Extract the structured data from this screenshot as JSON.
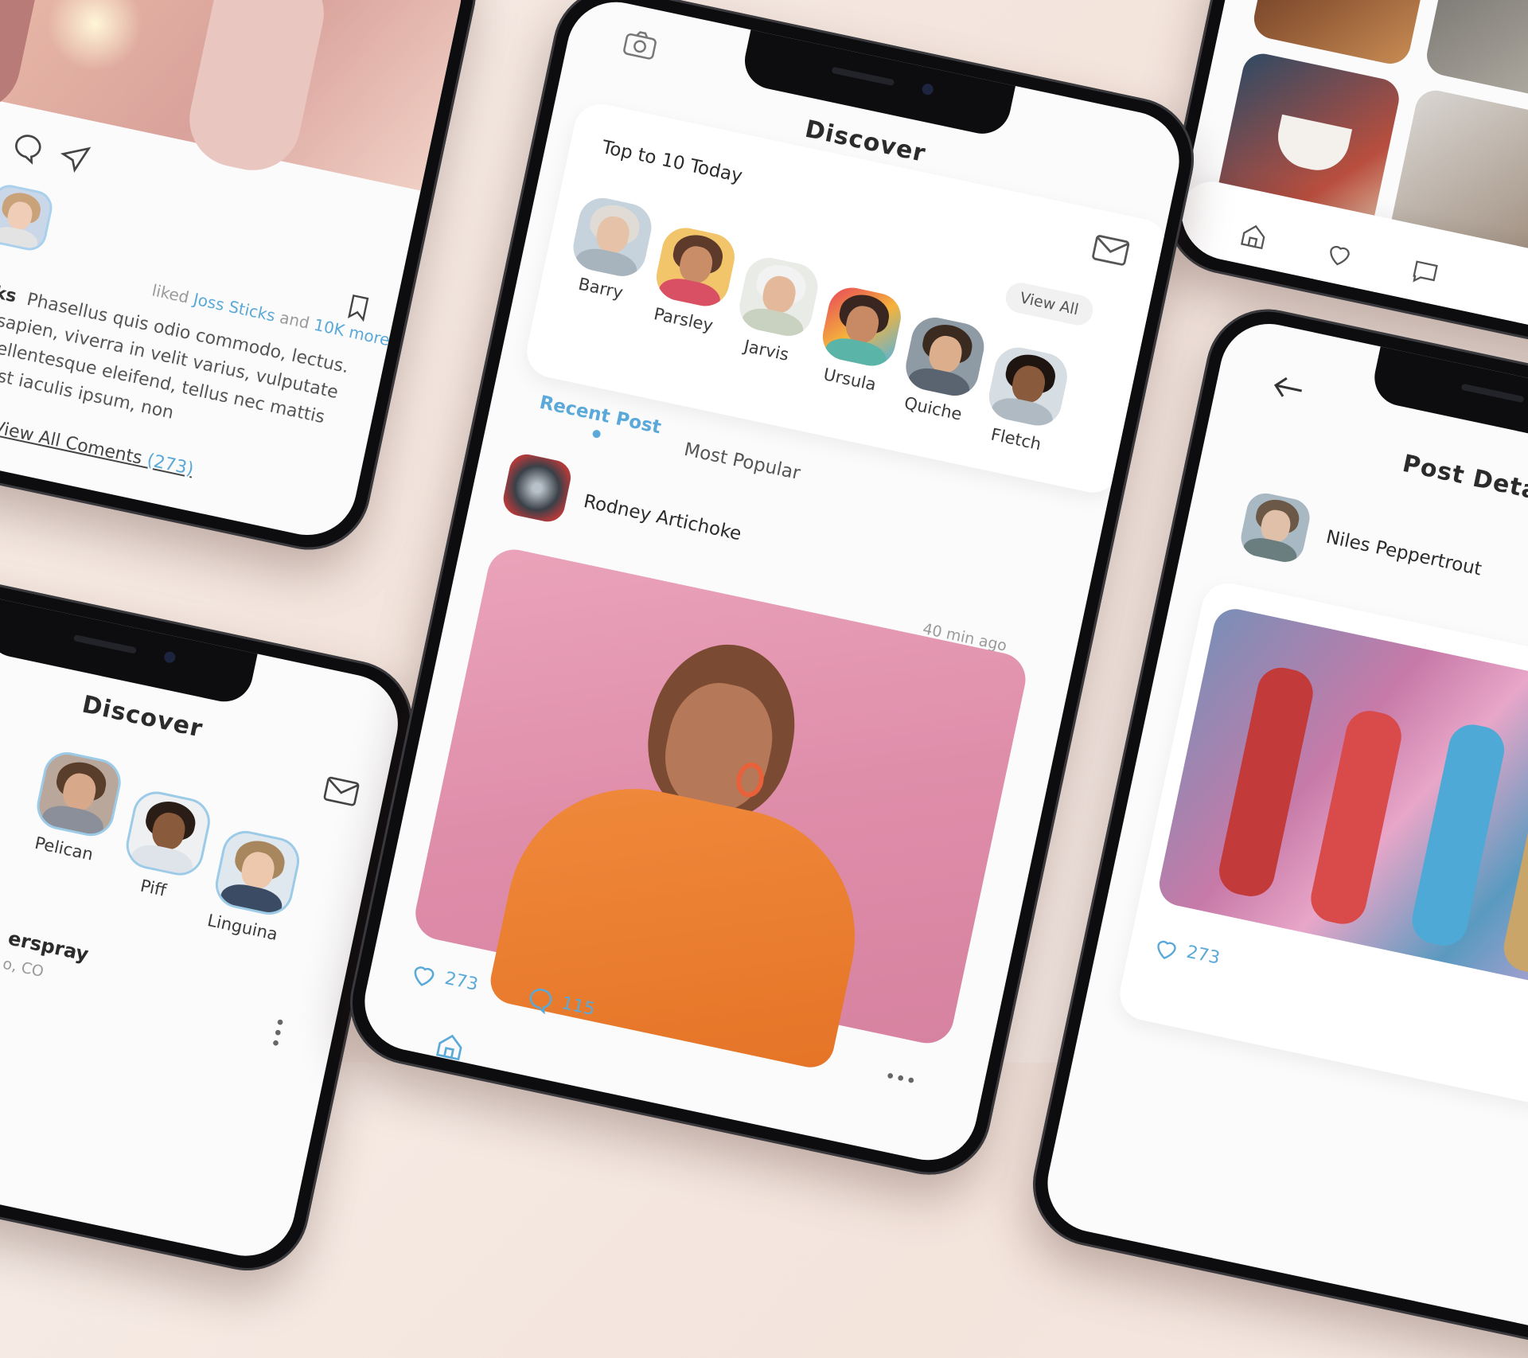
{
  "colors": {
    "accent": "#5aa9d8",
    "background": "#f5e8e1"
  },
  "center": {
    "title": "Discover",
    "section_title": "Top to 10 Today",
    "view_all": "View All",
    "stories": [
      {
        "name": "Barry"
      },
      {
        "name": "Parsley"
      },
      {
        "name": "Jarvis"
      },
      {
        "name": "Ursula"
      },
      {
        "name": "Quiche"
      },
      {
        "name": "Fletch"
      }
    ],
    "tabs": [
      {
        "label": "Recent Post"
      },
      {
        "label": "Most Popular"
      }
    ],
    "post": {
      "author": "Rodney Artichoke",
      "time": "40 min ago",
      "likes": "273",
      "comments": "115"
    },
    "icons": [
      "camera-icon",
      "mail-icon",
      "heart-icon",
      "comment-icon",
      "more-icon",
      "home-icon"
    ]
  },
  "top_left": {
    "liked_prefix": "liked",
    "liked_user": "Joss Sticks",
    "liked_and": "and",
    "liked_more": "10K more",
    "caption_author": "Sticks",
    "caption_lines": [
      "Phasellus quis odio commodo, lectus.",
      "urna sapien, viverra in velit varius, vulputate",
      "nisi. Pellentesque eleifend, tellus nec mattis",
      "risus est iaculis ipsum, non"
    ],
    "view_comments": "View All Coments",
    "comment_count": "(273)"
  },
  "bottom_left": {
    "title": "Discover",
    "stories": [
      {
        "name": "Pelican"
      },
      {
        "name": "Piff"
      },
      {
        "name": "Linguina"
      }
    ],
    "post_author": "erspray",
    "post_location": "o, CO"
  },
  "right": {
    "title": "Post Detail",
    "author": "Niles Peppertrout",
    "likes": "273"
  }
}
